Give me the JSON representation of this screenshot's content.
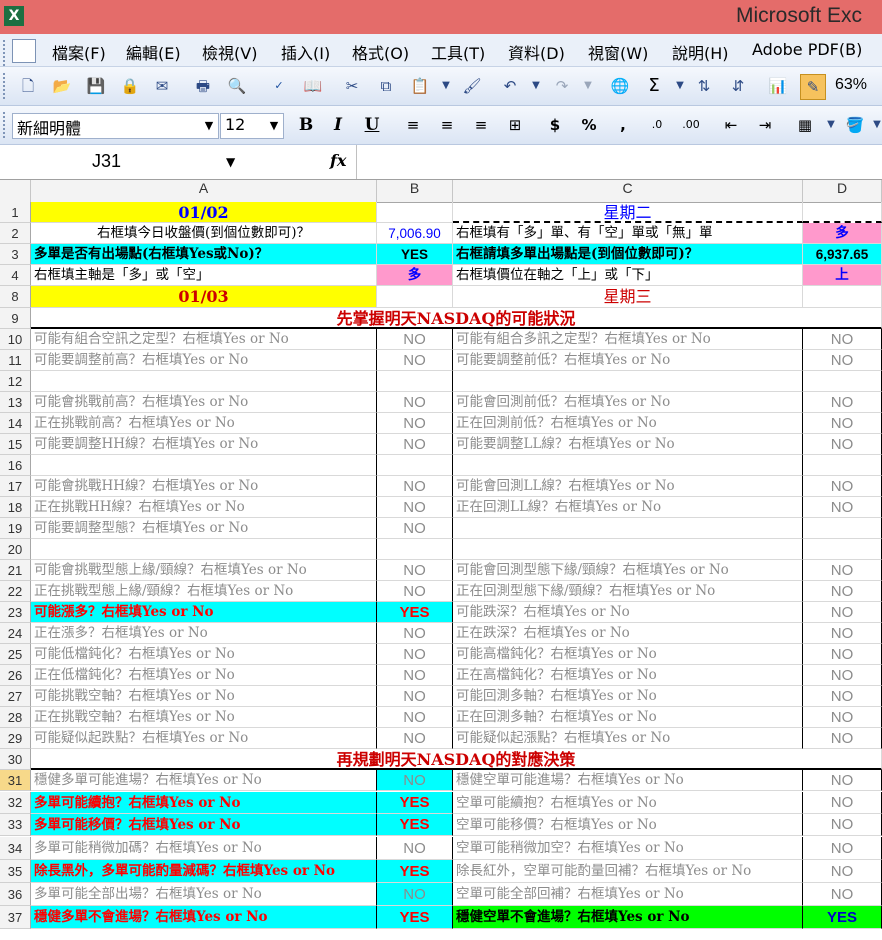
{
  "window": {
    "title": "Microsoft Exc",
    "app_icon": "X"
  },
  "menu": [
    "檔案(F)",
    "編輯(E)",
    "檢視(V)",
    "插入(I)",
    "格式(O)",
    "工具(T)",
    "資料(D)",
    "視窗(W)",
    "說明(H)",
    "Adobe PDF(B)"
  ],
  "toolbar": {
    "zoom": "63%"
  },
  "format_toolbar": {
    "font": "新細明體",
    "size": "12"
  },
  "formula_bar": {
    "name_box": "J31",
    "fx": "fx",
    "formula": ""
  },
  "columns": [
    "A",
    "B",
    "C",
    "D"
  ],
  "rows": [
    {
      "num": "1",
      "a": "01/02",
      "b": "",
      "c": "星期二",
      "d": ""
    },
    {
      "num": "2",
      "a": "右框填今日收盤價(到個位數即可)？",
      "b": "7,006.90",
      "c": "右框填有「多」單、有「空」單或「無」單",
      "d": "多"
    },
    {
      "num": "3",
      "a": "多單是否有出場點(右框填Yes或No)？",
      "b": "YES",
      "c": "右框請填多單出場點是(到個位數即可)？",
      "d": "6,937.65"
    },
    {
      "num": "4",
      "a": "右框填主軸是「多」或「空」",
      "b": "多",
      "c": "右框填價位在軸之「上」或「下」",
      "d": "上"
    },
    {
      "num": "8",
      "a": "01/03",
      "b": "",
      "c": "星期三",
      "d": ""
    },
    {
      "num": "9",
      "a": "先掌握明天NASDAQ的可能狀況",
      "b": "",
      "c": "",
      "d": ""
    },
    {
      "num": "10",
      "a": "可能有組合空訊之定型？右框填Yes or No",
      "b": "NO",
      "c": "可能有組合多訊之定型？右框填Yes or No",
      "d": "NO"
    },
    {
      "num": "11",
      "a": "可能要調整前高？右框填Yes or No",
      "b": "NO",
      "c": "可能要調整前低？右框填Yes or No",
      "d": "NO"
    },
    {
      "num": "12",
      "a": "",
      "b": "",
      "c": "",
      "d": ""
    },
    {
      "num": "13",
      "a": "可能會挑戰前高？右框填Yes or No",
      "b": "NO",
      "c": "可能會回測前低？右框填Yes or No",
      "d": "NO"
    },
    {
      "num": "14",
      "a": "正在挑戰前高？右框填Yes or No",
      "b": "NO",
      "c": "正在回測前低？右框填Yes or No",
      "d": "NO"
    },
    {
      "num": "15",
      "a": "可能要調整HH線？右框填Yes or No",
      "b": "NO",
      "c": "可能要調整LL線？右框填Yes or No",
      "d": "NO"
    },
    {
      "num": "16",
      "a": "",
      "b": "",
      "c": "",
      "d": ""
    },
    {
      "num": "17",
      "a": "可能會挑戰HH線？右框填Yes or No",
      "b": "NO",
      "c": "可能會回測LL線？右框填Yes or No",
      "d": "NO"
    },
    {
      "num": "18",
      "a": "正在挑戰HH線？右框填Yes or No",
      "b": "NO",
      "c": "正在回測LL線？右框填Yes or No",
      "d": "NO"
    },
    {
      "num": "19",
      "a": "可能要調整型態？右框填Yes or No",
      "b": "NO",
      "c": "",
      "d": ""
    },
    {
      "num": "20",
      "a": "",
      "b": "",
      "c": "",
      "d": ""
    },
    {
      "num": "21",
      "a": "可能會挑戰型態上緣/頸線？右框填Yes or No",
      "b": "NO",
      "c": "可能會回測型態下緣/頸線？右框填Yes or No",
      "d": "NO"
    },
    {
      "num": "22",
      "a": "正在挑戰型態上緣/頸線？右框填Yes or No",
      "b": "NO",
      "c": "正在回測型態下緣/頸線？右框填Yes or No",
      "d": "NO"
    },
    {
      "num": "23",
      "a": "可能漲多？右框填Yes or No",
      "b": "YES",
      "c": "可能跌深？右框填Yes or No",
      "d": "NO"
    },
    {
      "num": "24",
      "a": "正在漲多？右框填Yes or No",
      "b": "NO",
      "c": "正在跌深？右框填Yes or No",
      "d": "NO"
    },
    {
      "num": "25",
      "a": "可能低檔鈍化？右框填Yes or No",
      "b": "NO",
      "c": "可能高檔鈍化？右框填Yes or No",
      "d": "NO"
    },
    {
      "num": "26",
      "a": "正在低檔鈍化？右框填Yes or No",
      "b": "NO",
      "c": "正在高檔鈍化？右框填Yes or No",
      "d": "NO"
    },
    {
      "num": "27",
      "a": "可能挑戰空軸？右框填Yes or No",
      "b": "NO",
      "c": "可能回測多軸？右框填Yes or No",
      "d": "NO"
    },
    {
      "num": "28",
      "a": "正在挑戰空軸？右框填Yes or No",
      "b": "NO",
      "c": "正在回測多軸？右框填Yes or No",
      "d": "NO"
    },
    {
      "num": "29",
      "a": "可能疑似起跌點？右框填Yes or No",
      "b": "NO",
      "c": "可能疑似起漲點？右框填Yes or No",
      "d": "NO"
    },
    {
      "num": "30",
      "a": "再規劃明天NASDAQ的對應決策",
      "b": "",
      "c": "",
      "d": ""
    },
    {
      "num": "31",
      "a": "穩健多單可能進場？右框填Yes or No",
      "b": "NO",
      "c": "穩健空單可能進場？右框填Yes or No",
      "d": "NO"
    },
    {
      "num": "32",
      "a": "多單可能續抱？右框填Yes or No",
      "b": "YES",
      "c": "空單可能續抱？右框填Yes or No",
      "d": "NO"
    },
    {
      "num": "33",
      "a": "多單可能移價？右框填Yes or No",
      "b": "YES",
      "c": "空單可能移價？右框填Yes or No",
      "d": "NO"
    },
    {
      "num": "34",
      "a": "多單可能稍微加碼？右框填Yes or No",
      "b": "NO",
      "c": "空單可能稍微加空？右框填Yes or No",
      "d": "NO"
    },
    {
      "num": "35",
      "a": "除長黑外，多單可能酌量減碼？右框填Yes or No",
      "b": "YES",
      "c": "除長紅外，空單可能酌量回補？右框填Yes or No",
      "d": "NO"
    },
    {
      "num": "36",
      "a": "多單可能全部出場？右框填Yes or No",
      "b": "NO",
      "c": "空單可能全部回補？右框填Yes or No",
      "d": "NO"
    },
    {
      "num": "37",
      "a": "穩健多單不會進場？右框填Yes or No",
      "b": "YES",
      "c": "穩健空單不會進場？右框填Yes or No",
      "d": "YES"
    }
  ]
}
